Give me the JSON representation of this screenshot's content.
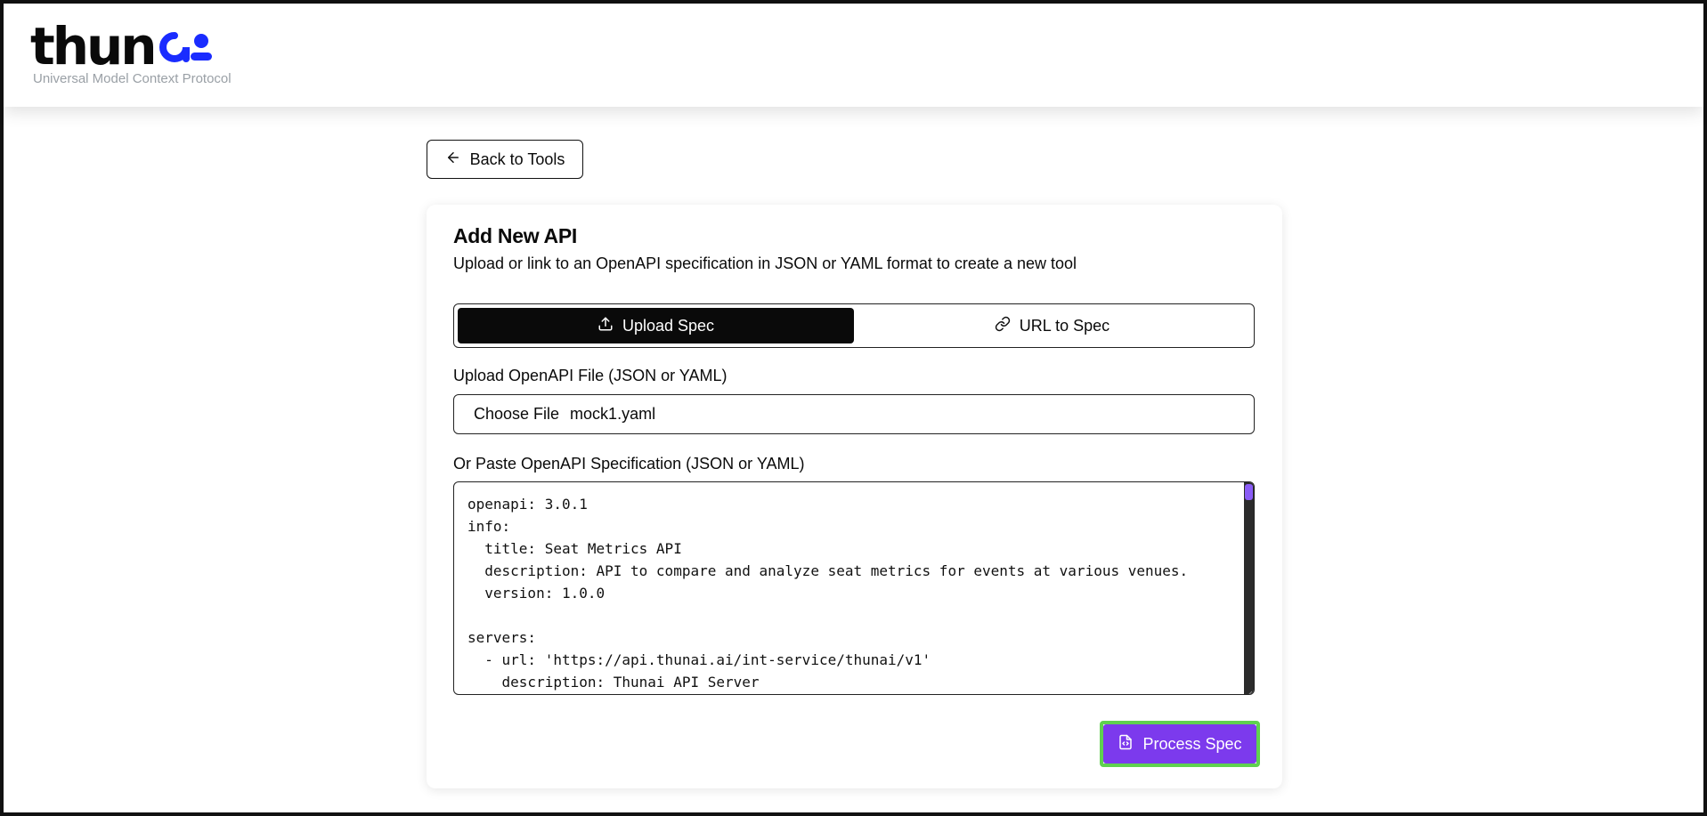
{
  "brand": {
    "logo_text": "thun",
    "tagline": "Universal Model Context Protocol",
    "accent_color": "#1a2cff"
  },
  "nav": {
    "back_label": "Back to Tools"
  },
  "card": {
    "title": "Add New API",
    "subtitle": "Upload or link to an OpenAPI specification in JSON or YAML format to create a new tool"
  },
  "tabs": [
    {
      "label": "Upload Spec",
      "icon": "upload-icon",
      "active": true
    },
    {
      "label": "URL to Spec",
      "icon": "link-icon",
      "active": false
    }
  ],
  "file_upload": {
    "label": "Upload OpenAPI File (JSON or YAML)",
    "button_label": "Choose File",
    "file_name": "mock1.yaml"
  },
  "spec_input": {
    "label": "Or Paste OpenAPI Specification (JSON or YAML)",
    "value": "openapi: 3.0.1\ninfo:\n  title: Seat Metrics API\n  description: API to compare and analyze seat metrics for events at various venues.\n  version: 1.0.0\n\nservers:\n  - url: 'https://api.thunai.ai/int-service/thunai/v1'\n    description: Thunai API Server"
  },
  "actions": {
    "process_label": "Process Spec",
    "process_color": "#7c3aed",
    "highlight_color": "#5fd14f"
  }
}
